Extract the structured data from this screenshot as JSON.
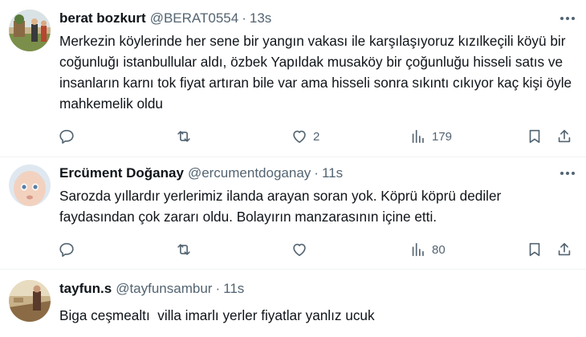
{
  "tweets": [
    {
      "name": "berat bozkurt",
      "handle": "@BERAT0554",
      "separator": "·",
      "time": "13s",
      "text": "Merkezin köylerinde her sene bir yangın vakası ile karşılaşıyoruz kızılkeçili köyü bir coğunluğı istanbullular aldı, özbek Yapıldak musaköy bir çoğunluğu hisseli satıs ve insanların karnı tok fiyat artıran bile var ama hisseli sonra sıkıntı cıkıyor kaç kişi öyle mahkemelik oldu",
      "likes": "2",
      "views": "179"
    },
    {
      "name": "Ercüment Doğanay",
      "handle": "@ercumentdoganay",
      "separator": "·",
      "time": "11s",
      "text": "Sarozda yıllardır yerlerimiz ilanda arayan soran yok. Köprü köprü dediler faydasından çok zararı oldu. Bolayırın manzarasının içine etti.",
      "likes": "",
      "views": "80"
    },
    {
      "name": "tayfun.s",
      "handle": "@tayfunsambur",
      "separator": "·",
      "time": "11s",
      "text": "Biga ceşmealtı  villa imarlı yerler fiyatlar yanlız ucuk"
    }
  ],
  "icons": {
    "reply": "reply-icon",
    "retweet": "retweet-icon",
    "like": "heart-icon",
    "views": "views-icon",
    "bookmark": "bookmark-icon",
    "share": "share-icon",
    "more": "more-icon"
  },
  "colors": {
    "secondary_text": "#536471",
    "primary_text": "#0f1419",
    "divider": "#eff3f4"
  }
}
